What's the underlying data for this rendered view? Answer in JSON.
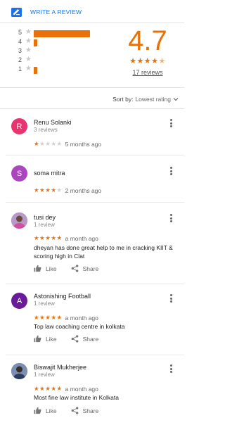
{
  "header": {
    "write_review_label": "WRITE A REVIEW"
  },
  "summary": {
    "score": "4.7",
    "stars_filled": 4,
    "review_count": "17 reviews",
    "histogram": [
      {
        "label": "5",
        "fraction": 1.0
      },
      {
        "label": "4",
        "fraction": 0.06
      },
      {
        "label": "3",
        "fraction": 0.0
      },
      {
        "label": "2",
        "fraction": 0.0
      },
      {
        "label": "1",
        "fraction": 0.06
      }
    ]
  },
  "sort": {
    "label": "Sort by:",
    "value": "Lowest rating"
  },
  "actions": {
    "like": "Like",
    "share": "Share"
  },
  "reviews": [
    {
      "initial": "R",
      "name": "Renu Solanki",
      "meta": "3 reviews",
      "rating": 1,
      "time": "5 months ago",
      "text": "",
      "avatar_color": "#e8336e"
    },
    {
      "initial": "S",
      "name": "soma mitra",
      "meta": "",
      "rating": 4,
      "time": "2 months ago",
      "text": "",
      "avatar_color": "#ab47bc"
    },
    {
      "initial": "",
      "name": "tusi dey",
      "meta": "1 review",
      "rating": 5,
      "time": "a month ago",
      "text": "dheyan has done great help to me in cracking KIIT & scoring high in Clat",
      "avatar_color": "#8e6b9e"
    },
    {
      "initial": "A",
      "name": "Astonishing Football",
      "meta": "1 review",
      "rating": 5,
      "time": "a month ago",
      "text": "Top law coaching centre in kolkata",
      "avatar_color": "#6a1b9a"
    },
    {
      "initial": "",
      "name": "Biswajit Mukherjee",
      "meta": "1 review",
      "rating": 5,
      "time": "a month ago",
      "text": "Most fine law institute in Kolkata",
      "avatar_color": "#4a5a7a"
    }
  ]
}
